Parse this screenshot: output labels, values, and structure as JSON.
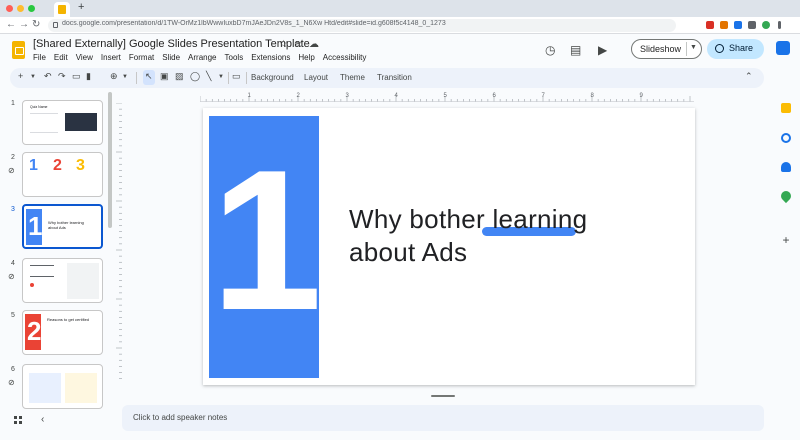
{
  "browser": {
    "url": "docs.google.com/presentation/d/1TW-OrMz1lbWwwIuxbD7mJAeJDn2V8s_1_N6Xw Htd/edit#slide=id.g608f5c4148_0_1273",
    "new_tab": "+",
    "back": "←",
    "forward": "→",
    "reload": "↻"
  },
  "header": {
    "title": "[Shared Externally] Google Slides Presentation Template",
    "menu": [
      "File",
      "Edit",
      "View",
      "Insert",
      "Format",
      "Slide",
      "Arrange",
      "Tools",
      "Extensions",
      "Help",
      "Accessibility"
    ],
    "slideshow_label": "Slideshow",
    "share_label": "Share"
  },
  "toolbar": {
    "background_label": "Background",
    "layout_label": "Layout",
    "theme_label": "Theme",
    "transition_label": "Transition"
  },
  "filmstrip": {
    "numbers": [
      "1",
      "2",
      "3",
      "4",
      "5",
      "6"
    ],
    "thumb1_title": "Quiz Name",
    "thumb3_text": "Why bother learning about Ads",
    "thumb5_text": "Reasons to get certified"
  },
  "slide": {
    "number": "1",
    "title_line1": "Why bother learning",
    "title_line2": "about Ads",
    "accent": "#4285f4"
  },
  "ruler": {
    "marks": [
      "1",
      "2",
      "3",
      "4",
      "5",
      "6",
      "7",
      "8",
      "9"
    ]
  },
  "notes": {
    "placeholder": "Click to add speaker notes"
  },
  "colors": {
    "slides_yellow": "#f4b400",
    "share_bg": "#c2e7ff",
    "selection": "#0b57d0"
  }
}
